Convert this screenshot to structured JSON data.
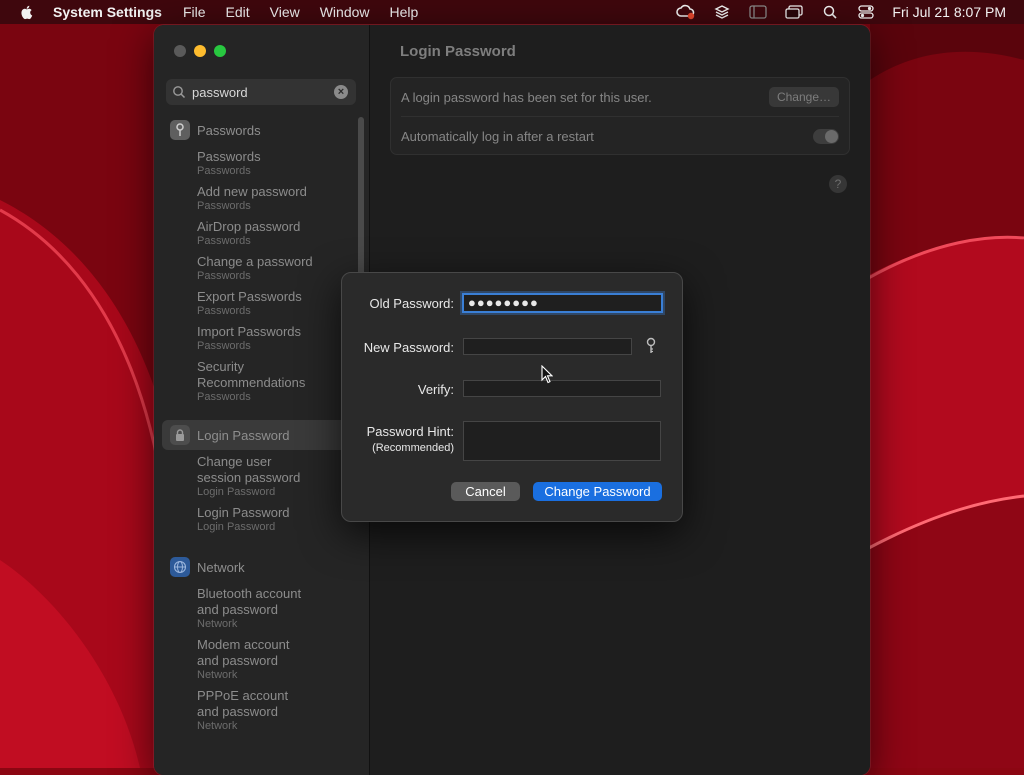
{
  "menubar": {
    "app_name": "System Settings",
    "menus": [
      "File",
      "Edit",
      "View",
      "Window",
      "Help"
    ],
    "clock": "Fri Jul 21  8:07 PM"
  },
  "sidebar": {
    "search": {
      "value": "password"
    },
    "groups": [
      {
        "label": "Passwords",
        "icon": "key-icon",
        "icon_color": "#6b6b6b",
        "selected": false,
        "items": [
          {
            "title": "Passwords",
            "subtitle": "Passwords"
          },
          {
            "title": "Add new password",
            "subtitle": "Passwords"
          },
          {
            "title": "AirDrop password",
            "subtitle": "Passwords"
          },
          {
            "title": "Change a password",
            "subtitle": "Passwords"
          },
          {
            "title": "Export Passwords",
            "subtitle": "Passwords"
          },
          {
            "title": "Import Passwords",
            "subtitle": "Passwords"
          },
          {
            "title": "Security Recommendations",
            "subtitle": "Passwords"
          }
        ]
      },
      {
        "label": "Login Password",
        "icon": "lock-icon",
        "icon_color": "#5a5a5a",
        "selected": true,
        "items": [
          {
            "title": "Change user session password",
            "subtitle": "Login Password"
          },
          {
            "title": "Login Password",
            "subtitle": "Login Password"
          }
        ]
      },
      {
        "label": "Network",
        "icon": "globe-icon",
        "icon_color": "#2d5a99",
        "selected": false,
        "items": [
          {
            "title": "Bluetooth account and password",
            "subtitle": "Network"
          },
          {
            "title": "Modem account and password",
            "subtitle": "Network"
          },
          {
            "title": "PPPoE account and password",
            "subtitle": "Network"
          }
        ]
      }
    ]
  },
  "content": {
    "title": "Login Password",
    "row1_text": "A login password has been set for this user.",
    "change_label": "Change…",
    "row2_text": "Automatically log in after a restart",
    "auto_login_enabled": false,
    "help_label": "?"
  },
  "dialog": {
    "old_password_label": "Old Password:",
    "old_password_value": "●●●●●●●●",
    "new_password_label": "New Password:",
    "verify_label": "Verify:",
    "hint_label": "Password Hint:",
    "hint_sublabel": "(Recommended)",
    "cancel_label": "Cancel",
    "change_password_label": "Change Password"
  },
  "colors": {
    "wallpaper": "#8c0612",
    "accent": "#1a6fe0",
    "focus_ring": "#3a7fd6"
  }
}
